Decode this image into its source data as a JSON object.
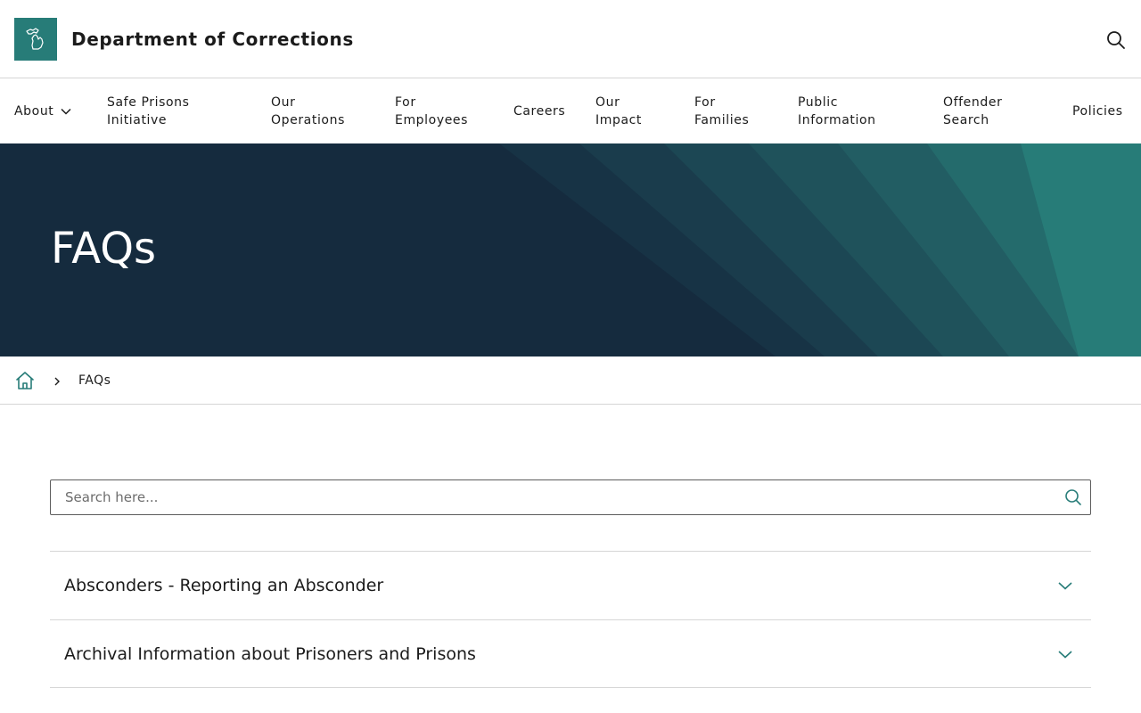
{
  "header": {
    "title": "Department of Corrections",
    "logo_icon": "michigan-state-icon",
    "search_icon": "search-icon"
  },
  "nav": {
    "items": [
      {
        "label": "About",
        "has_dropdown": true
      },
      {
        "label_line1": "Safe Prisons",
        "label_line2": "Initiative"
      },
      {
        "label_line1": "Our",
        "label_line2": "Operations"
      },
      {
        "label_line1": "For",
        "label_line2": "Employees"
      },
      {
        "label": "Careers"
      },
      {
        "label_line1": "Our",
        "label_line2": "Impact"
      },
      {
        "label_line1": "For",
        "label_line2": "Families"
      },
      {
        "label_line1": "Public",
        "label_line2": "Information"
      },
      {
        "label_line1": "Offender",
        "label_line2": "Search"
      },
      {
        "label": "Policies"
      }
    ]
  },
  "hero": {
    "title": "FAQs"
  },
  "breadcrumb": {
    "home_icon": "home-icon",
    "current": "FAQs"
  },
  "faq_search": {
    "placeholder": "Search here...",
    "value": ""
  },
  "faq_items": [
    {
      "title": "Absconders - Reporting an Absconder"
    },
    {
      "title": "Archival Information about Prisoners and Prisons"
    }
  ],
  "colors": {
    "brand_teal": "#277c78",
    "hero_navy": "#152b3e",
    "text": "#1b1b1b"
  }
}
